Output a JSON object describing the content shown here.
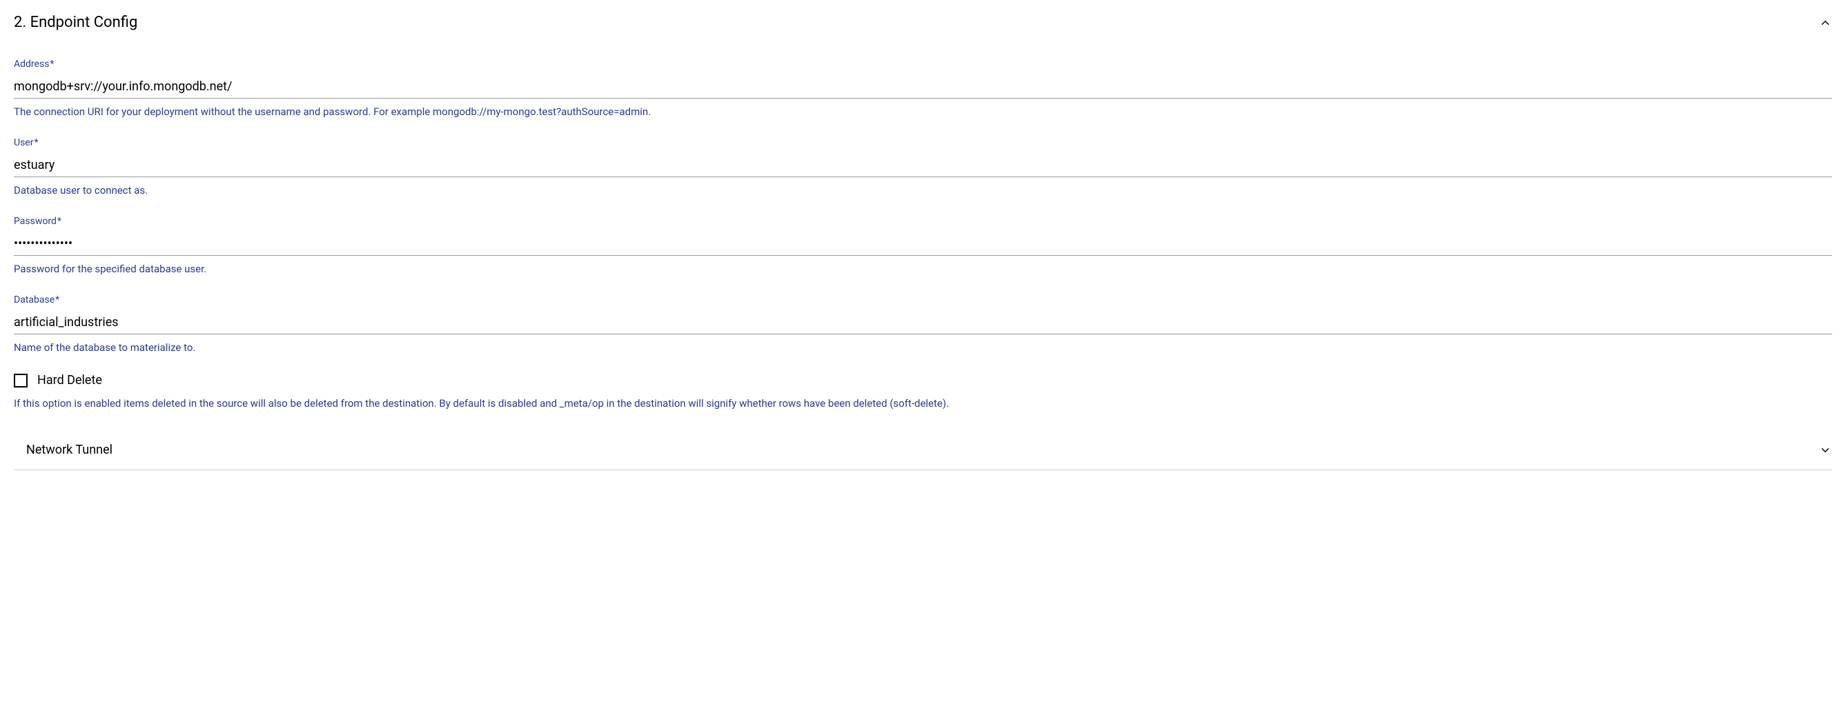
{
  "section": {
    "title": "2. Endpoint Config"
  },
  "fields": {
    "address": {
      "label": "Address",
      "required": "*",
      "value": "mongodb+srv://your.info.mongodb.net/",
      "help": "The connection URI for your deployment without the username and password. For example mongodb://my-mongo.test?authSource=admin."
    },
    "user": {
      "label": "User",
      "required": "*",
      "value": "estuary",
      "help": "Database user to connect as."
    },
    "password": {
      "label": "Password",
      "required": "*",
      "value": "••••••••••••••",
      "help": "Password for the specified database user."
    },
    "database": {
      "label": "Database",
      "required": "*",
      "value": "artificial_industries",
      "help": "Name of the database to materialize to."
    }
  },
  "hardDelete": {
    "label": "Hard Delete",
    "help": "If this option is enabled items deleted in the source will also be deleted from the destination. By default is disabled and _meta/op in the destination will signify whether rows have been deleted (soft-delete)."
  },
  "networkTunnel": {
    "title": "Network Tunnel"
  }
}
